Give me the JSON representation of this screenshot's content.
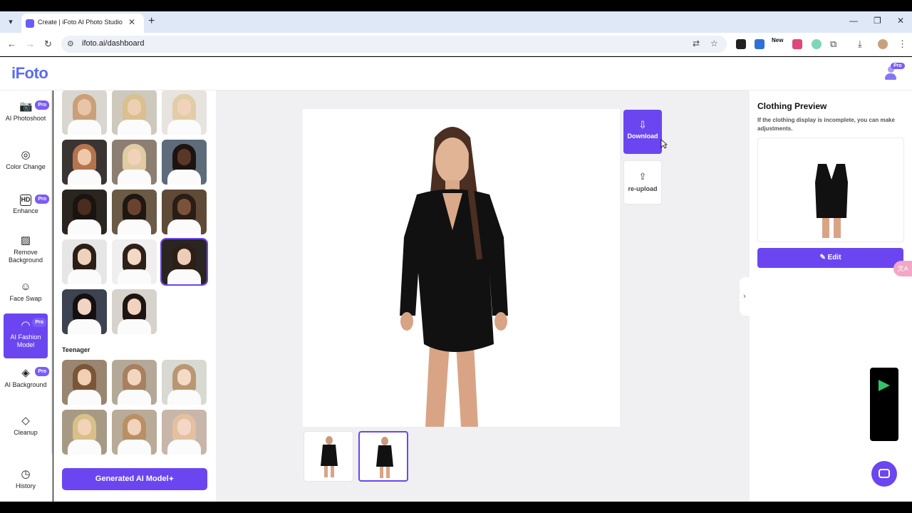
{
  "browser": {
    "tab_title": "Create | iFoto AI Photo Studio |",
    "url": "ifoto.ai/dashboard",
    "ext_new_label": "New"
  },
  "app": {
    "logo": "iFoto",
    "pro_label": "Pro"
  },
  "sidebar": {
    "items": [
      {
        "label": "AI Photoshoot",
        "icon": "camera-icon",
        "pro": true
      },
      {
        "label": "Color Change",
        "icon": "palette-icon",
        "pro": false
      },
      {
        "label": "Enhance",
        "icon": "hd-icon",
        "pro": true
      },
      {
        "label": "Remove Background",
        "icon": "remove-bg-icon",
        "pro": false
      },
      {
        "label": "Face Swap",
        "icon": "face-swap-icon",
        "pro": false
      },
      {
        "label": "AI Fashion Model",
        "icon": "fashion-model-icon",
        "pro": true,
        "active": true
      },
      {
        "label": "AI Background",
        "icon": "layers-icon",
        "pro": true
      },
      {
        "label": "Cleanup",
        "icon": "eraser-icon",
        "pro": false
      },
      {
        "label": "History",
        "icon": "history-icon",
        "pro": false
      }
    ]
  },
  "model_panel": {
    "section_teenager": "Teenager",
    "generate_button": "Generated AI Model",
    "selected_index": 11
  },
  "actions": {
    "download": "Download",
    "reupload": "re-upload"
  },
  "clothing_preview": {
    "title": "Clothing Preview",
    "description": "If the clothing display is incomplete, you can make adjustments.",
    "edit_button": "Edit"
  },
  "colors": {
    "accent": "#6b46f0",
    "background": "#f0f0f3"
  }
}
